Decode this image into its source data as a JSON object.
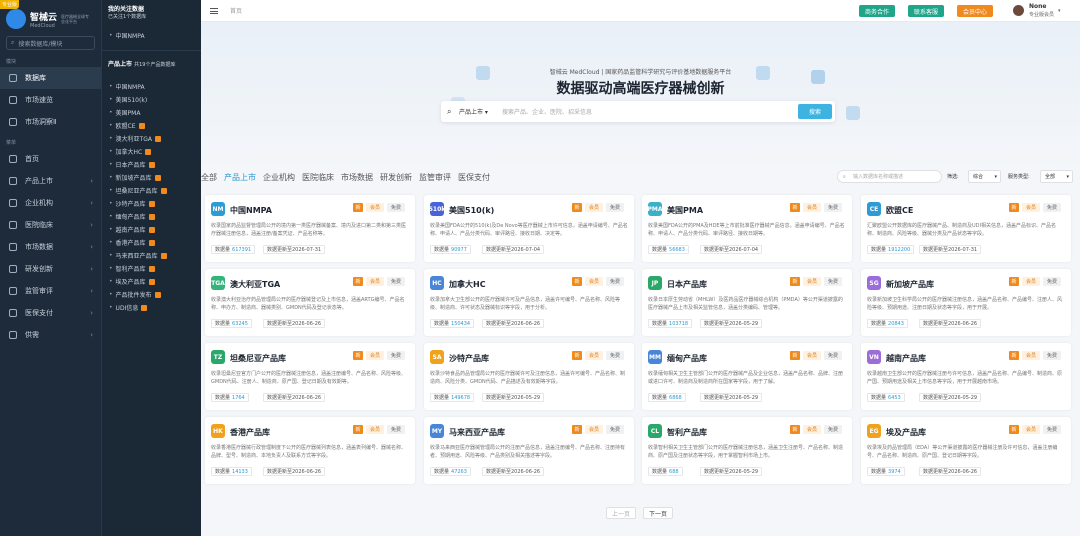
{
  "sidebar": {
    "badge": "专业版",
    "brand": "智械云",
    "brand_en": "MedCloud",
    "slogan": "医疗器械全球专业化平台",
    "search_placeholder": "搜索数据库/模块",
    "section1": "模块",
    "top_items": [
      "数据库",
      "市场速览",
      "市场洞察Ⅱ"
    ],
    "section2": "菜单",
    "items": [
      {
        "label": "首页",
        "arrow": ""
      },
      {
        "label": "产品上市",
        "arrow": "›"
      },
      {
        "label": "企业机构",
        "arrow": "›"
      },
      {
        "label": "医院临床",
        "arrow": "›"
      },
      {
        "label": "市场数据",
        "arrow": "›"
      },
      {
        "label": "研发创新",
        "arrow": "›"
      },
      {
        "label": "监管审评",
        "arrow": "›"
      },
      {
        "label": "医保支付",
        "arrow": "›"
      },
      {
        "label": "供需",
        "arrow": "›"
      }
    ]
  },
  "sub": {
    "fav_title": "我的关注数据",
    "fav_sub": "已关注1个数据库",
    "fav_items": [
      "中国NMPA"
    ],
    "list_title": "产品上市",
    "list_sub": "共19个产品数据库",
    "items": [
      {
        "label": "中国NMPA",
        "flag": false
      },
      {
        "label": "美国510(k)",
        "flag": false
      },
      {
        "label": "美国PMA",
        "flag": false
      },
      {
        "label": "欧盟CE",
        "flag": true
      },
      {
        "label": "澳大利亚TGA",
        "flag": true
      },
      {
        "label": "加拿大HC",
        "flag": true
      },
      {
        "label": "日本产品库",
        "flag": true
      },
      {
        "label": "新加坡产品库",
        "flag": true
      },
      {
        "label": "坦桑尼亚产品库",
        "flag": true
      },
      {
        "label": "沙特产品库",
        "flag": true
      },
      {
        "label": "缅甸产品库",
        "flag": true
      },
      {
        "label": "越南产品库",
        "flag": true
      },
      {
        "label": "香港产品库",
        "flag": true
      },
      {
        "label": "马来西亚产品库",
        "flag": true
      },
      {
        "label": "智利产品库",
        "flag": true
      },
      {
        "label": "埃及产品库",
        "flag": true
      },
      {
        "label": "产品批件发布",
        "flag": true
      },
      {
        "label": "UDI信息",
        "flag": true
      }
    ]
  },
  "topbar": {
    "breadcrumb": "首页",
    "btn1": "商务合作",
    "btn2": "联系客服",
    "btn3": "会员中心",
    "user_name": "None",
    "user_level": "专业版会员"
  },
  "hero": {
    "subtitle": "智械云 MedCloud | 国家药品监管科学研究与评价基地数据服务平台",
    "title": "数据驱动高端医疗器械创新",
    "scope": "产品上市",
    "placeholder": "搜索产品、企业、医院、招采信息",
    "button": "搜索"
  },
  "tabs": [
    "全部",
    "产品上市",
    "企业机构",
    "医院临床",
    "市场数据",
    "研发创新",
    "监管审评",
    "医保支付"
  ],
  "filters": {
    "search_placeholder": "输入数据库名称或描述",
    "sort_label": "筛选:",
    "sort_value": "综合",
    "type_label": "服务类型:",
    "type_value": "全部"
  },
  "tags": {
    "new": "新",
    "member": "会员",
    "free": "免费"
  },
  "cards": [
    {
      "name": "中国NMPA",
      "icon": "NM",
      "color": "#2d9bd4",
      "desc": "收录国家药品监督管理局公开的境内第一类医疗器械备案、境内及进口第二类和第三类医疗器械注册信息，涵盖注册/备案凭证、产品名称等。",
      "count_label": "数据量",
      "count": "617391",
      "updated": "数据更新至2026-07-31"
    },
    {
      "name": "美国510(k)",
      "icon": "510k",
      "color": "#4a64d8",
      "desc": "收录美国FDA公开的510(k)及De Novo等医疗器械上市许可信息，涵盖申请编号、产品名称、申请人、产品分类代码、审评路径、接收日期、决定等。",
      "count_label": "数据量",
      "count": "90977",
      "updated": "数据更新至2026-07-04"
    },
    {
      "name": "美国PMA",
      "icon": "PMA",
      "color": "#3ab0c9",
      "desc": "收录美国FDA公开的PMA及HDE等上市前批准医疗器械产品信息，涵盖申请编号、产品名称、申请人、产品分类代码、审评路径、接收日期等。",
      "count_label": "数据量",
      "count": "56683",
      "updated": "数据更新至2026-07-04"
    },
    {
      "name": "欧盟CE",
      "icon": "CE",
      "color": "#2d9bd4",
      "desc": "汇聚欧盟公开数据库的医疗器械产品、制造商及UDI相关信息，涵盖产品标识、产品名称、制造商、风险等级、器械分类及产品状态等字段。",
      "count_label": "数据量",
      "count": "1912200",
      "updated": "数据更新至2026-07-31"
    },
    {
      "name": "澳大利亚TGA",
      "icon": "TGA",
      "color": "#34b37a",
      "desc": "收录澳大利亚治疗药品管理局公开的医疗器械登记及上市信息，涵盖ARTG编号、产品名称、申办方、制造商、器械类别、GMDN代码及登记状态等。",
      "count_label": "数据量",
      "count": "63245",
      "updated": "数据更新至2026-06-26"
    },
    {
      "name": "加拿大HC",
      "icon": "HC",
      "color": "#4a86d8",
      "desc": "收录加拿大卫生部公开的医疗器械许可及产品信息，涵盖许可编号、产品名称、风险等级、制造商、许可状态及器械标识等字段，用于分析。",
      "count_label": "数据量",
      "count": "150434",
      "updated": "数据更新至2026-06-26"
    },
    {
      "name": "日本产品库",
      "icon": "JP",
      "color": "#2aa86a",
      "desc": "收录日本厚生劳动省（MHLW）及医药品医疗器械综合机构（PMDA）等公开渠道披露的医疗器械产品上市及相关监管信息，涵盖分类编码、管理等。",
      "count_label": "数据量",
      "count": "103718",
      "updated": "数据更新至2026-05-29"
    },
    {
      "name": "新加坡产品库",
      "icon": "SG",
      "color": "#9b6dd8",
      "desc": "收录新加坡卫生科学局公开的医疗器械注册信息，涵盖产品名称、产品编号、注册人、风险等级、预期用途、注册日期及状态等字段，用于开展。",
      "count_label": "数据量",
      "count": "20843",
      "updated": "数据更新至2026-06-26"
    },
    {
      "name": "坦桑尼亚产品库",
      "icon": "TZ",
      "color": "#2aa86a",
      "desc": "收录坦桑尼亚官方门户公开的医疗器械注册信息，涵盖注册编号、产品名称、风险等级、GMDN代码、注册人、制造商、原产国、登记日期及有效期等。",
      "count_label": "数据量",
      "count": "1764",
      "updated": "数据更新至2026-06-26"
    },
    {
      "name": "沙特产品库",
      "icon": "SA",
      "color": "#f0a21c",
      "desc": "收录沙特食品药品管理局公开的医疗器械许可及注册信息，涵盖许可编号、产品名称、制造商、风险分类、GMDN代码、产品描述及有效期等字段。",
      "count_label": "数据量",
      "count": "149678",
      "updated": "数据更新至2026-05-29"
    },
    {
      "name": "缅甸产品库",
      "icon": "MM",
      "color": "#4a86d8",
      "desc": "收录缅甸相关卫生主管部门公开的医疗器械产品及企业信息，涵盖产品名称、品牌、注册或进口许可、制造商及制造商所在国家等字段，用于了解。",
      "count_label": "数据量",
      "count": "6868",
      "updated": "数据更新至2026-05-29"
    },
    {
      "name": "越南产品库",
      "icon": "VN",
      "color": "#9b6dd8",
      "desc": "收录越南卫生部公开的医疗器械注册与许可信息，涵盖产品名称、产品编号、制造商、原产国、预期用途及相关上市信息等字段，用于开展越南市场。",
      "count_label": "数据量",
      "count": "6453",
      "updated": "数据更新至2026-05-29"
    },
    {
      "name": "香港产品库",
      "icon": "HK",
      "color": "#f0a21c",
      "desc": "收录香港医疗器械行政管理制度下公开的医疗器械列表信息，涵盖表列编号、器械名称、品牌、型号、制造商、本地负责人及联系方式等字段。",
      "count_label": "数据量",
      "count": "14133",
      "updated": "数据更新至2026-06-26"
    },
    {
      "name": "马来西亚产品库",
      "icon": "MY",
      "color": "#4a86d8",
      "desc": "收录马来西亚医疗器械管理局公开的注册产品信息，涵盖注册编号、产品名称、注册持有者、预期用途、风险等级、产品类别及相关描述等字段。",
      "count_label": "数据量",
      "count": "47263",
      "updated": "数据更新至2026-06-26"
    },
    {
      "name": "智利产品库",
      "icon": "CL",
      "color": "#2aa86a",
      "desc": "收录智利相关卫生主管部门公开的医疗器械注册信息，涵盖卫生注册号、产品名称、制造商、原产国及注册状态等字段，用于掌握智利市场上市。",
      "count_label": "数据量",
      "count": "688",
      "updated": "数据更新至2026-05-29"
    },
    {
      "name": "埃及产品库",
      "icon": "EG",
      "color": "#f0a21c",
      "desc": "收录埃及药品管理局（EDA）等公开渠道披露的医疗器械注册及许可信息，涵盖注册编号、产品名称、制造商、原产国、登记日期等字段。",
      "count_label": "数据量",
      "count": "3974",
      "updated": "数据更新至2026-06-26"
    }
  ],
  "pagination": {
    "prev": "上一页",
    "next": "下一页"
  }
}
